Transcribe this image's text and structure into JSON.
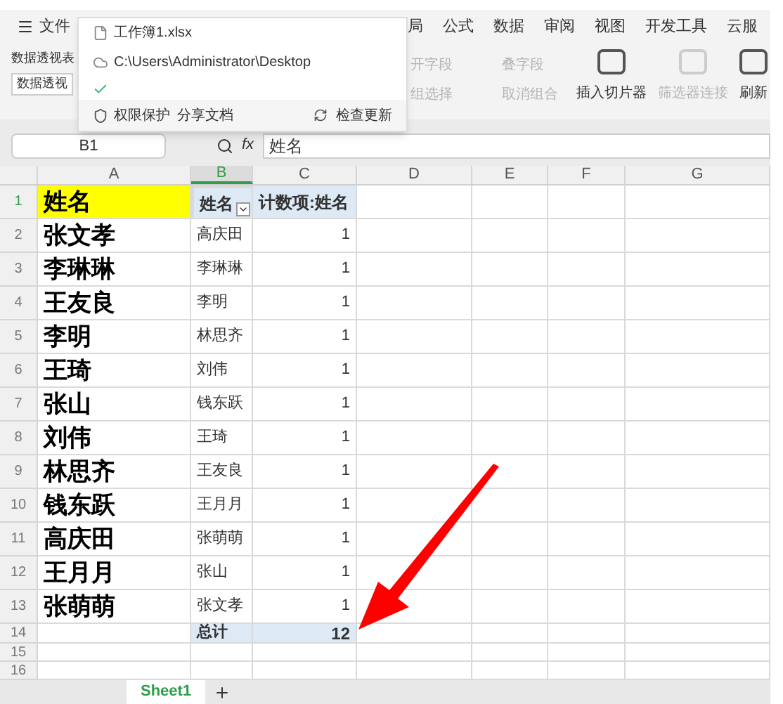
{
  "menu": {
    "label": "文件"
  },
  "ribbon_tabs": [
    {
      "label": "局",
      "selected": false
    },
    {
      "label": "公式",
      "selected": false
    },
    {
      "label": "数据",
      "selected": false
    },
    {
      "label": "审阅",
      "selected": false
    },
    {
      "label": "视图",
      "selected": false
    },
    {
      "label": "开发工具",
      "selected": false
    },
    {
      "label": "云服",
      "selected": false
    }
  ],
  "pivot_name": {
    "label": "数据透视表",
    "value": "数据透视"
  },
  "ribbon_small": [
    {
      "label": "开字段",
      "disabled": true
    },
    {
      "label": "叠字段",
      "disabled": true
    },
    {
      "label": "组选择",
      "disabled": true
    },
    {
      "label": "取消组合",
      "disabled": true
    }
  ],
  "ribbon_large": [
    {
      "label": "插入切片器",
      "disabled": false
    },
    {
      "label": "筛选器连接",
      "disabled": true
    },
    {
      "label": "刷新",
      "disabled": false
    }
  ],
  "popup": {
    "file": "工作簿1.xlsx",
    "path": "C:\\Users\\Administrator\\Desktop",
    "footer_left": [
      "权限保护",
      "分享文档"
    ],
    "footer_right": "检查更新"
  },
  "name_box": "B1",
  "fx_label": "fx",
  "formula": "姓名",
  "columns": [
    {
      "label": "A",
      "selected": false
    },
    {
      "label": "B",
      "selected": true
    },
    {
      "label": "C",
      "selected": false
    },
    {
      "label": "D",
      "selected": false
    },
    {
      "label": "E",
      "selected": false
    },
    {
      "label": "F",
      "selected": false
    },
    {
      "label": "G",
      "selected": false
    }
  ],
  "rows": [
    {
      "number": "1",
      "kind": "header",
      "cells": [
        "姓名",
        "姓名",
        "计数项:姓名"
      ]
    },
    {
      "number": "2",
      "kind": "data",
      "cells": [
        "张文孝",
        "高庆田",
        "1"
      ]
    },
    {
      "number": "3",
      "kind": "data",
      "cells": [
        "李琳琳",
        "李琳琳",
        "1"
      ]
    },
    {
      "number": "4",
      "kind": "data",
      "cells": [
        "王友良",
        "李明",
        "1"
      ]
    },
    {
      "number": "5",
      "kind": "data",
      "cells": [
        "李明",
        "林思齐",
        "1"
      ]
    },
    {
      "number": "6",
      "kind": "data",
      "cells": [
        "王琦",
        "刘伟",
        "1"
      ]
    },
    {
      "number": "7",
      "kind": "data",
      "cells": [
        "张山",
        "钱东跃",
        "1"
      ]
    },
    {
      "number": "8",
      "kind": "data",
      "cells": [
        "刘伟",
        "王琦",
        "1"
      ]
    },
    {
      "number": "9",
      "kind": "data",
      "cells": [
        "林思齐",
        "王友良",
        "1"
      ]
    },
    {
      "number": "10",
      "kind": "data",
      "cells": [
        "钱东跃",
        "王月月",
        "1"
      ]
    },
    {
      "number": "11",
      "kind": "data",
      "cells": [
        "高庆田",
        "张萌萌",
        "1"
      ]
    },
    {
      "number": "12",
      "kind": "data",
      "cells": [
        "王月月",
        "张山",
        "1"
      ]
    },
    {
      "number": "13",
      "kind": "data",
      "cells": [
        "张萌萌",
        "张文孝",
        "1"
      ]
    },
    {
      "number": "14",
      "kind": "total",
      "cells": [
        "",
        "总计",
        "12"
      ]
    },
    {
      "number": "15",
      "kind": "empty",
      "cells": []
    },
    {
      "number": "16",
      "kind": "empty",
      "cells": []
    }
  ],
  "sheet_tabs": [
    {
      "label": "Sheet1",
      "selected": true
    }
  ]
}
